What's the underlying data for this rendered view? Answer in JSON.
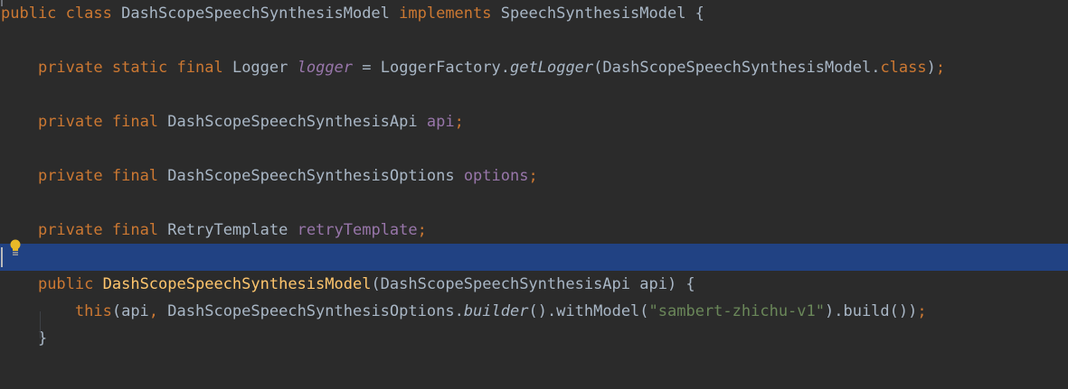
{
  "editor": {
    "lines": [
      [
        {
          "t": "public",
          "c": "kw"
        },
        {
          "t": " ",
          "c": "pn"
        },
        {
          "t": "class",
          "c": "kw"
        },
        {
          "t": " DashScopeSpeechSynthesisModel ",
          "c": "id"
        },
        {
          "t": "implements",
          "c": "kw"
        },
        {
          "t": " SpeechSynthesisModel {",
          "c": "id"
        }
      ],
      [],
      [
        {
          "t": "    ",
          "c": "pn"
        },
        {
          "t": "private",
          "c": "kw"
        },
        {
          "t": " ",
          "c": "pn"
        },
        {
          "t": "static",
          "c": "kw"
        },
        {
          "t": " ",
          "c": "pn"
        },
        {
          "t": "final",
          "c": "kw"
        },
        {
          "t": " Logger ",
          "c": "id"
        },
        {
          "t": "logger",
          "c": "sfld"
        },
        {
          "t": " = LoggerFactory.",
          "c": "id"
        },
        {
          "t": "getLogger",
          "c": "sm"
        },
        {
          "t": "(DashScopeSpeechSynthesisModel.",
          "c": "id"
        },
        {
          "t": "class",
          "c": "kw"
        },
        {
          "t": ")",
          "c": "id"
        },
        {
          "t": ";",
          "c": "semi"
        }
      ],
      [],
      [
        {
          "t": "    ",
          "c": "pn"
        },
        {
          "t": "private",
          "c": "kw"
        },
        {
          "t": " ",
          "c": "pn"
        },
        {
          "t": "final",
          "c": "kw"
        },
        {
          "t": " DashScopeSpeechSynthesisApi ",
          "c": "id"
        },
        {
          "t": "api",
          "c": "fld"
        },
        {
          "t": ";",
          "c": "semi"
        }
      ],
      [],
      [
        {
          "t": "    ",
          "c": "pn"
        },
        {
          "t": "private",
          "c": "kw"
        },
        {
          "t": " ",
          "c": "pn"
        },
        {
          "t": "final",
          "c": "kw"
        },
        {
          "t": " DashScopeSpeechSynthesisOptions ",
          "c": "id"
        },
        {
          "t": "options",
          "c": "fld"
        },
        {
          "t": ";",
          "c": "semi"
        }
      ],
      [],
      [
        {
          "t": "    ",
          "c": "pn"
        },
        {
          "t": "private",
          "c": "kw"
        },
        {
          "t": " ",
          "c": "pn"
        },
        {
          "t": "final",
          "c": "kw"
        },
        {
          "t": " RetryTemplate ",
          "c": "id"
        },
        {
          "t": "retryTemplate",
          "c": "fld"
        },
        {
          "t": ";",
          "c": "semi"
        }
      ],
      [],
      [
        {
          "t": "    ",
          "c": "pn"
        },
        {
          "t": "public",
          "c": "kw"
        },
        {
          "t": " ",
          "c": "pn"
        },
        {
          "t": "DashScopeSpeechSynthesisModel",
          "c": "fnd"
        },
        {
          "t": "(DashScopeSpeechSynthesisApi api) {",
          "c": "id"
        }
      ],
      [
        {
          "t": "        ",
          "c": "pn"
        },
        {
          "t": "this",
          "c": "kw"
        },
        {
          "t": "(api",
          "c": "id"
        },
        {
          "t": ",",
          "c": "semi"
        },
        {
          "t": " DashScopeSpeechSynthesisOptions.",
          "c": "id"
        },
        {
          "t": "builder",
          "c": "sm"
        },
        {
          "t": "().withModel(",
          "c": "id"
        },
        {
          "t": "\"sambert-zhichu-v1\"",
          "c": "str"
        },
        {
          "t": ").build())",
          "c": "id"
        },
        {
          "t": ";",
          "c": "semi"
        }
      ],
      [
        {
          "t": "    }",
          "c": "id"
        }
      ]
    ],
    "current_line_index": 9,
    "bulb_icon": "lightbulb-intention-icon",
    "colors": {
      "background": "#2b2b2b",
      "keyword": "#cc7832",
      "identifier": "#a9b7c6",
      "field": "#9876aa",
      "declaration": "#ffc66d",
      "string": "#6a8759",
      "current_line": "#214283",
      "bulb": "#e8b928"
    }
  }
}
